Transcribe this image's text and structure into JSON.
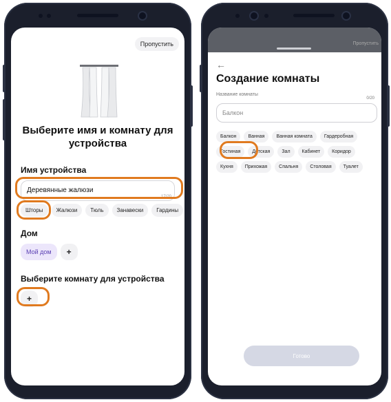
{
  "left_screen": {
    "skip_label": "Пропустить",
    "title": "Выберите имя и комнату для устройства",
    "device_name_label": "Имя устройства",
    "device_name_value": "Деревянные жалюзи",
    "device_name_counter": "17/20",
    "name_suggestions": [
      "Шторы",
      "Жалюзи",
      "Тюль",
      "Занавески",
      "Гардины"
    ],
    "home_label": "Дом",
    "home_value": "Мой дом",
    "add_home": "+",
    "room_label": "Выберите комнату для устройства",
    "add_room": "+"
  },
  "right_screen": {
    "back_icon": "arrow-left-icon",
    "skip_label": "Пропустить",
    "title": "Создание комнаты",
    "field_label": "Название комнаты",
    "field_counter": "0/20",
    "field_value": "Балкон",
    "room_suggestions": [
      "Балкон",
      "Ванная",
      "Ванная комната",
      "Гардеробная",
      "Гостиная",
      "Детская",
      "Зал",
      "Кабинет",
      "Коридор",
      "Кухня",
      "Прихожая",
      "Спальня",
      "Столовая",
      "Туалет"
    ],
    "done_label": "Готово"
  },
  "colors": {
    "highlight": "#e07a1f",
    "phone_body": "#1b1f2c",
    "accent_purple": "#5a3fb3"
  }
}
